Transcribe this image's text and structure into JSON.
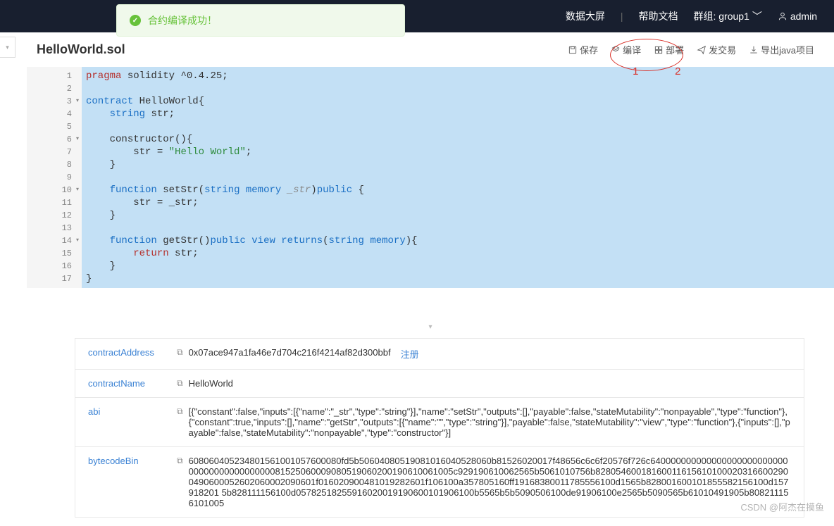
{
  "topbar": {
    "data_screen": "数据大屏",
    "help_doc": "帮助文档",
    "group_label": "群组: group1",
    "user": "admin"
  },
  "toast": {
    "message": "合约编译成功！"
  },
  "file": {
    "name": "HelloWorld.sol"
  },
  "actions": {
    "save": "保存",
    "compile": "编译",
    "deploy": "部署",
    "send_tx": "发交易",
    "export": "导出java项目",
    "annot1": "1",
    "annot2": "2"
  },
  "code": {
    "lines": 17,
    "l1a": "pragma",
    "l1b": "solidity ^0.4.25;",
    "l3a": "contract",
    "l3b": "HelloWorld{",
    "l4a": "string",
    "l4b": "str;",
    "l6a": "constructor",
    "l6b": "(){",
    "l7a": "str = ",
    "l7b": "\"Hello World\"",
    "l7c": ";",
    "l8": "}",
    "l10a": "function",
    "l10b": "setStr",
    "l10c": "(",
    "l10d": "string memory",
    "l10e": "_str",
    "l10f": ")",
    "l10g": "public",
    "l10h": " {",
    "l11": "str = _str;",
    "l12": "}",
    "l14a": "function",
    "l14b": "getStr",
    "l14c": "()",
    "l14d": "public view returns",
    "l14e": "(",
    "l14f": "string memory",
    "l14g": "){",
    "l15a": "return",
    "l15b": " str;",
    "l16": "}",
    "l17": "}"
  },
  "info": {
    "addr_label": "contractAddress",
    "addr_value": "0x07ace947a1fa46e7d704c216f4214af82d300bbf",
    "register": "注册",
    "name_label": "contractName",
    "name_value": "HelloWorld",
    "abi_label": "abi",
    "abi_value": "[{\"constant\":false,\"inputs\":[{\"name\":\"_str\",\"type\":\"string\"}],\"name\":\"setStr\",\"outputs\":[],\"payable\":false,\"stateMutability\":\"nonpayable\",\"type\":\"function\"},{\"constant\":true,\"inputs\":[],\"name\":\"getStr\",\"outputs\":[{\"name\":\"\",\"type\":\"string\"}],\"payable\":false,\"stateMutability\":\"view\",\"type\":\"function\"},{\"inputs\":[],\"payable\":false,\"stateMutability\":\"nonpayable\",\"type\":\"constructor\"}]",
    "bin_label": "bytecodeBin",
    "bin_value": "608060405234801561001057600080fd5b50604080519081016040528060b81526020017f48656c6c6f20576f726c6400000000000000000000000000000000000000000081525060009080519060200190610061005c929190610062565b5061010756b828054600181600116156101000203166002900490600052602060002090601f016020900481019282601f106100a357805160ff19168380011785556100d1565b828001600101855582156100d157918201 5b828111156100d05782518255916020019190600101906100b5565b5b5090506100de91906100e2565b5090565b61010491905b808211156101005"
  },
  "watermark": "CSDN @阿杰在摸鱼"
}
